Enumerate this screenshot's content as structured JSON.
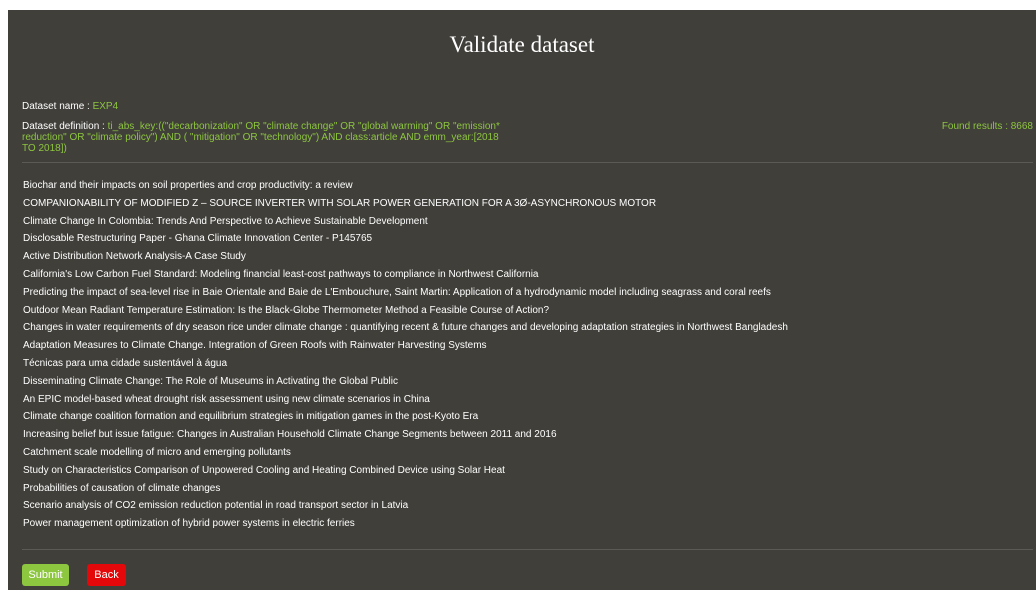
{
  "page": {
    "title": "Validate dataset"
  },
  "dataset": {
    "name_label": "Dataset name : ",
    "name_value": "EXP4",
    "definition_label": "Dataset definition : ",
    "definition_value": "ti_abs_key:((\"decarbonization\" OR \"climate change\" OR \"global warming\" OR \"emission* reduction\" OR \"climate policy\") AND ( \"mitigation\" OR \"technology\") AND class:article AND emm_year:[2018 TO 2018])",
    "found_results": "Found results : 8668"
  },
  "results": [
    "Biochar and their impacts on soil properties and crop productivity: a review",
    "COMPANIONABILITY OF MODIFIED Z – SOURCE INVERTER WITH SOLAR POWER GENERATION FOR A 3Ø-ASYNCHRONOUS MOTOR",
    "Climate Change In Colombia: Trends And Perspective to Achieve Sustainable Development",
    "Disclosable Restructuring Paper - Ghana Climate Innovation Center - P145765",
    "Active Distribution Network Analysis-A Case Study",
    "California's Low Carbon Fuel Standard: Modeling financial least-cost pathways to compliance in Northwest California",
    "Predicting the impact of sea-level rise in Baie Orientale and Baie de L'Embouchure, Saint Martin: Application of a hydrodynamic model including seagrass and coral reefs",
    "Outdoor Mean Radiant Temperature Estimation: Is the Black-Globe Thermometer Method a Feasible Course of Action?",
    "Changes in water requirements of dry season rice under climate change : quantifying recent & future changes and developing adaptation strategies in Northwest Bangladesh",
    "Adaptation Measures to Climate Change. Integration of Green Roofs with Rainwater Harvesting Systems",
    "Técnicas para uma cidade sustentável à água",
    "Disseminating Climate Change: The Role of Museums in Activating the Global Public",
    "An EPIC model-based wheat drought risk assessment using new climate scenarios in China",
    "Climate change coalition formation and equilibrium strategies in mitigation games in the post-Kyoto Era",
    "Increasing belief but issue fatigue: Changes in Australian Household Climate Change Segments between 2011 and 2016",
    "Catchment scale modelling of micro and emerging pollutants",
    "Study on Characteristics Comparison of Unpowered Cooling and Heating Combined Device using Solar Heat",
    "Probabilities of causation of climate changes",
    "Scenario analysis of CO2 emission reduction potential in road transport sector in Latvia",
    "Power management optimization of hybrid power systems in electric ferries"
  ],
  "actions": {
    "submit_label": "Submit",
    "back_label": "Back"
  },
  "colors": {
    "background": "#403f3a",
    "accent_green": "#8dc63f",
    "back_red": "#e4080a"
  }
}
